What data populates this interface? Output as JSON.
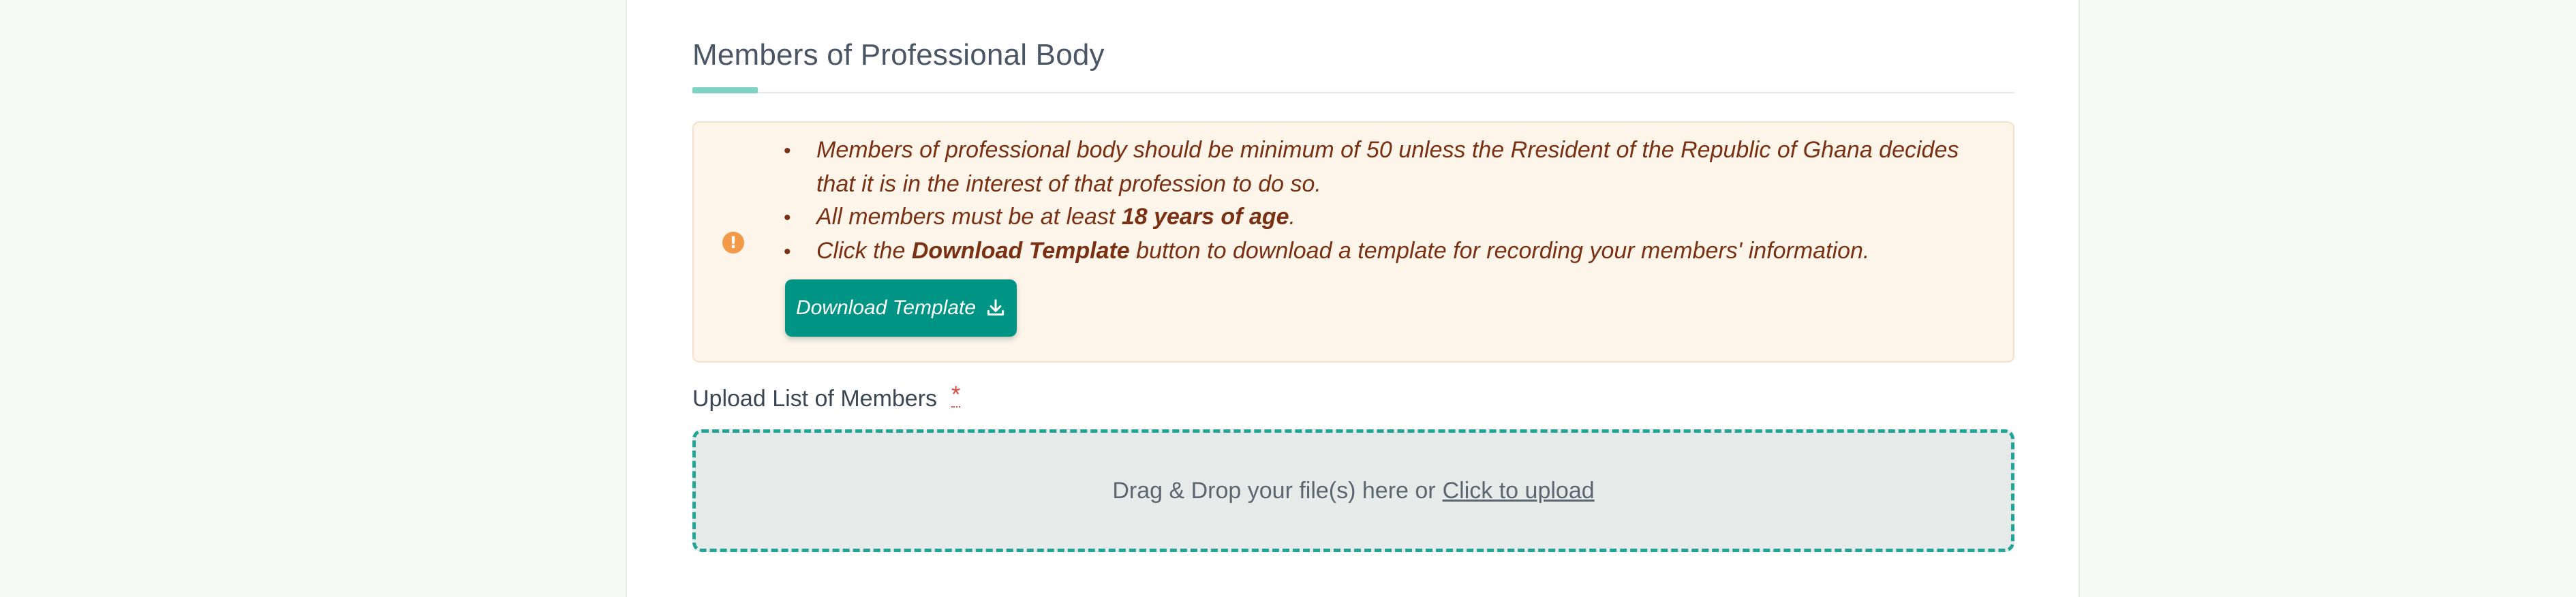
{
  "section": {
    "title": "Members of Professional Body"
  },
  "notice": {
    "icon": "alert-circle-icon",
    "bullet": "•",
    "item1": "Members of professional body should be minimum of 50 unless the Rresident of the Republic of Ghana decides that it is in the interest of that profession to do so.",
    "item2_prefix": "All members must be at least ",
    "item2_bold": "18 years of age",
    "item2_suffix": ".",
    "item3_prefix": "Click the ",
    "item3_bold": "Download Template",
    "item3_suffix": " button to download a template for recording your members' information."
  },
  "download_button": {
    "label": "Download Template",
    "icon": "download-icon"
  },
  "upload": {
    "label": "Upload List of Members",
    "required_mark": "*",
    "prompt": "Drag & Drop your file(s) here or",
    "link": "Click to upload"
  },
  "colors": {
    "page_background": "#f6fbf5",
    "accent": "#009485",
    "notice_background": "#fef5ea",
    "notice_text": "#7a3012",
    "dropzone_border": "#22a597",
    "required": "#e0463c"
  }
}
